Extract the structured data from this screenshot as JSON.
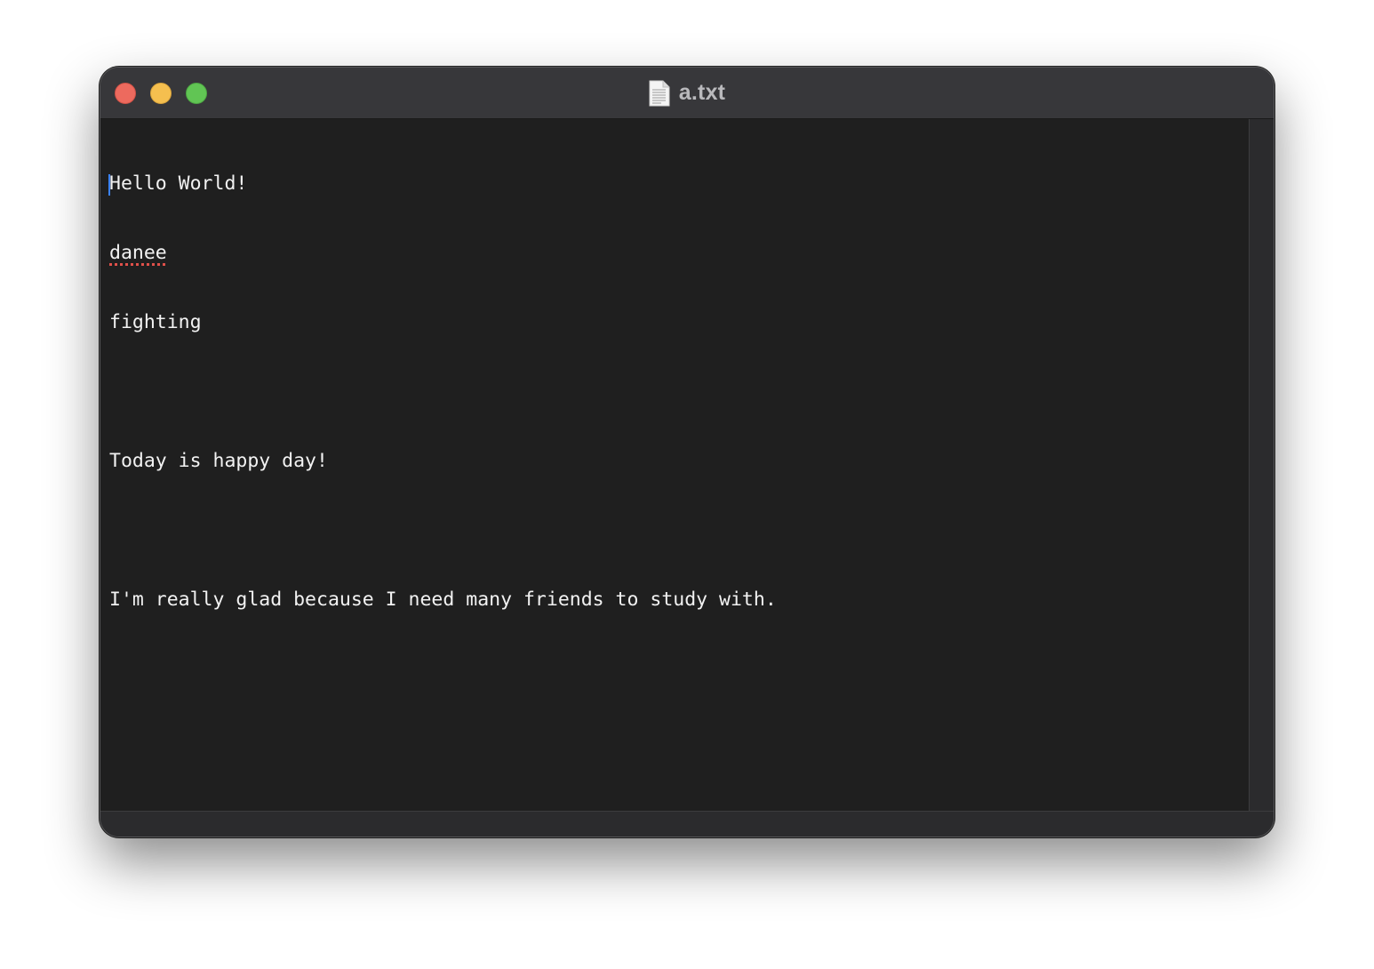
{
  "window": {
    "title": "a.txt",
    "icon": "text-document-icon",
    "controls": {
      "close_color": "#ed6a5e",
      "minimize_color": "#f5bf4f",
      "zoom_color": "#61c554"
    }
  },
  "editor": {
    "lines": [
      "Hello World!",
      "danee",
      "fighting",
      "",
      "Today is happy day!",
      "",
      "I'm really glad because I need many friends to study with."
    ],
    "misspelled_word": "danee",
    "caret_color": "#3b82f6",
    "background": "#1f1f1f",
    "text_color": "#f2f2f2"
  }
}
